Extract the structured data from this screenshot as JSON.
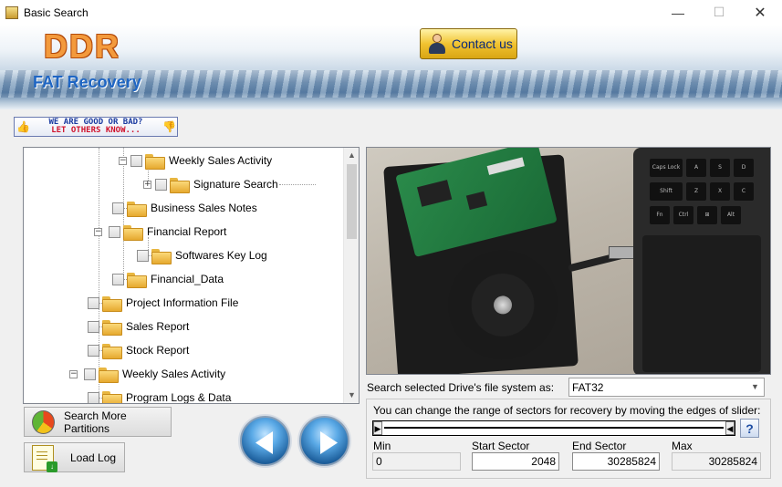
{
  "window": {
    "title": "Basic Search",
    "controls": {
      "minimize": "—",
      "maximize": "☐",
      "close": "✕"
    }
  },
  "banner": {
    "logo": "DDR",
    "subtitle": "FAT Recovery",
    "contact_label": "Contact us"
  },
  "rating": {
    "line1": "WE ARE GOOD OR BAD?",
    "line2": "LET OTHERS KNOW..."
  },
  "tree": {
    "items": [
      {
        "label": "Weekly Sales Activity",
        "expander": "−"
      },
      {
        "label": "Signature Search",
        "expander": "+"
      },
      {
        "label": "Business Sales Notes",
        "expander": ""
      },
      {
        "label": "Financial Report",
        "expander": "−"
      },
      {
        "label": "Softwares Key Log",
        "expander": ""
      },
      {
        "label": "Financial_Data",
        "expander": ""
      },
      {
        "label": "Project Information File",
        "expander": ""
      },
      {
        "label": "Sales Report",
        "expander": ""
      },
      {
        "label": "Stock Report",
        "expander": ""
      },
      {
        "label": "Weekly Sales Activity",
        "expander": "−"
      },
      {
        "label": "Program Logs & Data",
        "expander": ""
      }
    ],
    "scroll_up": "▲",
    "scroll_down": "▼"
  },
  "preview": {
    "keys": [
      "Caps Lock",
      "A",
      "S",
      "D",
      "Shift",
      "Z",
      "X",
      "C",
      "Fn",
      "Ctrl",
      "⊞",
      "Alt"
    ]
  },
  "filesystem": {
    "label": "Search selected Drive's file system as:",
    "value": "FAT32",
    "dropdown_icon": "▼"
  },
  "sectors": {
    "hint": "You can change the range of sectors for recovery by moving the edges of slider:",
    "slider_left": "▶",
    "slider_right": "◀",
    "help": "?",
    "min_label": "Min",
    "min_value": "0",
    "start_label": "Start Sector",
    "start_value": "2048",
    "end_label": "End Sector",
    "end_value": "30285824",
    "max_label": "Max",
    "max_value": "30285824"
  },
  "buttons": {
    "search_more": "Search More Partitions",
    "load_log": "Load Log"
  },
  "colors": {
    "accent": "#1f66c4",
    "logo": "#f39a3c",
    "contact": "#f1c331"
  }
}
